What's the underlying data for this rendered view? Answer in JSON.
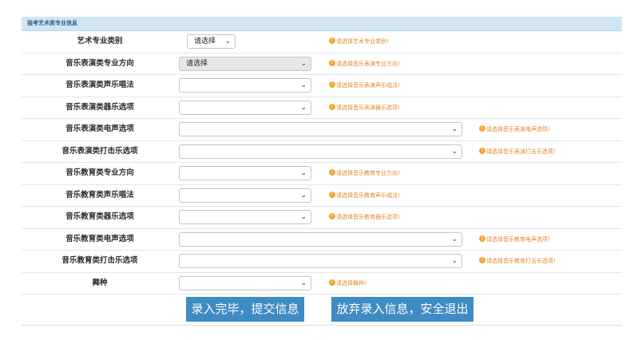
{
  "section_title": "报考艺术类专业信息",
  "rows": [
    {
      "label": "艺术专业类别",
      "select": "请选择",
      "hint": "请选择艺术专业类别!"
    },
    {
      "label": "音乐表演类专业方向",
      "select": "请选择",
      "hint": "请选择音乐表演专业方向!"
    },
    {
      "label": "音乐表演类声乐唱法",
      "select": "",
      "hint": "请选择音乐表演声乐唱法!"
    },
    {
      "label": "音乐表演类器乐选项",
      "select": "",
      "hint": "请选择音乐表演器乐选项!"
    },
    {
      "label": "音乐表演类电声选项",
      "select": "",
      "hint": "请选择音乐表演电声选项!"
    },
    {
      "label": "音乐表演类打击乐选项",
      "select": "",
      "hint": "请选择音乐表演打击乐选项!"
    },
    {
      "label": "音乐教育类专业方向",
      "select": "",
      "hint": "请选择音乐教育专业方向!"
    },
    {
      "label": "音乐教育类声乐唱法",
      "select": "",
      "hint": "请选择音乐教育声乐唱法!"
    },
    {
      "label": "音乐教育类器乐选项",
      "select": "",
      "hint": "请选择音乐教育器乐选项!"
    },
    {
      "label": "音乐教育类电声选项",
      "select": "",
      "hint": "请选择音乐教育电声选项!"
    },
    {
      "label": "音乐教育类打击乐选项",
      "select": "",
      "hint": "请选择音乐教育打击乐选项!"
    },
    {
      "label": "舞种",
      "select": "",
      "hint": "请选择舞种!"
    }
  ],
  "buttons": {
    "submit": "录入完毕，提交信息",
    "quit": "放弃录入信息，安全退出"
  },
  "icons": {
    "chevron": "chevron-down-icon",
    "hint": "warning-circle-icon"
  },
  "colors": {
    "header_bg": "#cfe5f5",
    "hint_text": "#e0892b",
    "button_bg": "#3f8bc4"
  }
}
